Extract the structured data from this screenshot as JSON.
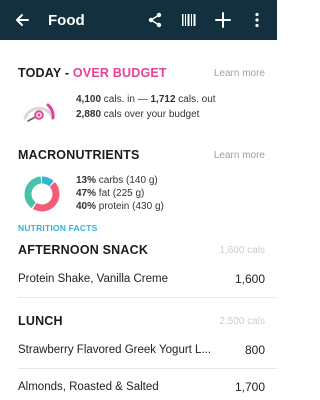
{
  "appbar": {
    "title": "Food",
    "icons": [
      "back-arrow-icon",
      "share-icon",
      "barcode-icon",
      "plus-icon",
      "more-vert-icon"
    ]
  },
  "budget": {
    "title_prefix": "TODAY - ",
    "title_alert": "OVER BUDGET",
    "learn_more": "Learn more",
    "cals_in": "4,100",
    "in_label": " cals. in — ",
    "cals_out": "1,712",
    "out_label": " cals. out",
    "over_value": "2,880",
    "over_label": " cals over your budget",
    "alert_color": "#e84393"
  },
  "macros": {
    "title": "MACRONUTRIENTS",
    "learn_more": "Learn more",
    "items": [
      {
        "pct": "13%",
        "label": " carbs (140 g)",
        "fraction": 0.13,
        "color": "#2fb6d6"
      },
      {
        "pct": "47%",
        "label": " fat (225 g)",
        "fraction": 0.47,
        "color": "#f25c78"
      },
      {
        "pct": "40%",
        "label": " protein (430 g)",
        "fraction": 0.4,
        "color": "#47c2a8"
      }
    ],
    "nutrition_facts": "NUTRITION FACTS"
  },
  "meals": [
    {
      "title": "AFTERNOON SNACK",
      "cals": "1,600 cals",
      "foods": [
        {
          "name": "Protein Shake, Vanilla Creme",
          "value": "1,600"
        }
      ]
    },
    {
      "title": "LUNCH",
      "cals": "2,500 cals",
      "foods": [
        {
          "name": "Strawberry Flavored Greek Yogurt L...",
          "value": "800"
        },
        {
          "name": "Almonds, Roasted & Salted",
          "value": "1,700"
        }
      ]
    }
  ]
}
